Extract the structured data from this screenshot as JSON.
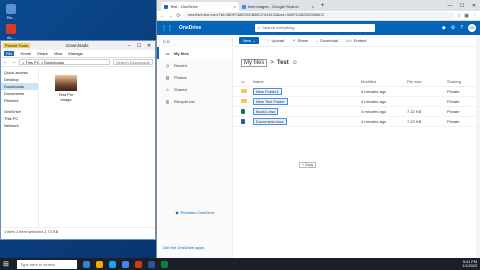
{
  "desktop": {
    "icons": [
      {
        "label": "Re...",
        "color": "#5a8fd0"
      },
      {
        "label": "Ac...",
        "color": "#d83a2a"
      },
      {
        "label": "Ch...",
        "color": "#2aa84a"
      }
    ]
  },
  "explorer": {
    "title": "Downloads",
    "tools_badge": "Picture Tools",
    "ribbon_tabs": [
      "File",
      "Home",
      "Share",
      "View",
      "Manage"
    ],
    "address": "> This PC > Downloads",
    "search_placeholder": "Search Downloads",
    "nav": [
      "Quick access",
      "Desktop",
      "Downloads",
      "Documents",
      "Pictures",
      "OneDrive",
      "This PC",
      "Network"
    ],
    "selected_nav": "Downloads",
    "thumb_label": "Test Pro Image",
    "status": "1 item   1 item selected 2.73 KB"
  },
  "chrome": {
    "tabs": [
      {
        "label": "Test - OneDrive",
        "close": "×"
      },
      {
        "label": "test images - Google Search",
        "close": "×"
      }
    ],
    "new_tab": "+",
    "window_controls": [
      "—",
      "☐",
      "✕"
    ],
    "url": "onedrive.live.com/?id=36DFC6B230CB68C2%21133&cid=36DFC6B230CB68C2",
    "onedrive": {
      "brand": "OneDrive",
      "search_placeholder": "Search everything",
      "avatar": "CK",
      "user": "C K",
      "nav": [
        "My files",
        "Recent",
        "Photos",
        "Shared",
        "Recycle bin"
      ],
      "active_nav": "My files",
      "premium": "Premium OneDrive",
      "get_apps": "Get the OneDrive apps",
      "commands": [
        "New",
        "Upload",
        "Share",
        "Download",
        "Embed"
      ],
      "breadcrumb": [
        "My files",
        "Test"
      ],
      "columns": [
        "Name",
        "Modified",
        "File size",
        "Sharing"
      ],
      "rows": [
        {
          "name": "New Folder1",
          "modified": "4 minutes ago",
          "size": "",
          "sharing": "Private",
          "type": "folder"
        },
        {
          "name": "New Text Folder",
          "modified": "4 minutes ago",
          "size": "",
          "sharing": "Private",
          "type": "folder"
        },
        {
          "name": "Book1.xlsx",
          "modified": "4 minutes ago",
          "size": "7.22 KB",
          "sharing": "Private",
          "type": "doc"
        },
        {
          "name": "Document.docx",
          "modified": "4 minutes ago",
          "size": "7.22 KB",
          "sharing": "Private",
          "type": "doc"
        }
      ],
      "drag_hint": "+ Copy"
    }
  },
  "taskbar": {
    "search_placeholder": "Type here to search",
    "time": "5:41 PM",
    "date": "1/1/2023",
    "apps": [
      "#2b88d8",
      "#f2a900",
      "#1da1f2",
      "#4285f4",
      "#c43e1c",
      "#2b579a",
      "#107c41"
    ]
  }
}
